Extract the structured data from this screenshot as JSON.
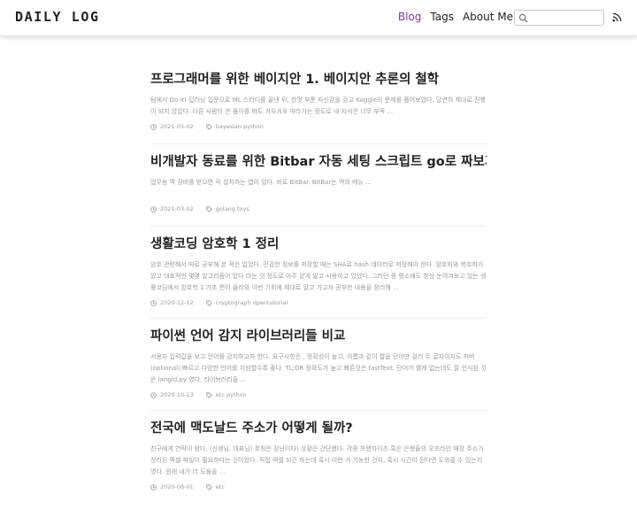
{
  "site": {
    "title": "DAILY LOG"
  },
  "nav": {
    "items": [
      {
        "label": "Blog",
        "active": true
      },
      {
        "label": "Tags",
        "active": false
      },
      {
        "label": "About Me",
        "active": false
      }
    ]
  },
  "search": {
    "placeholder": "",
    "value": ""
  },
  "colors": {
    "accent": "#7a3a93",
    "muted": "#999999"
  },
  "icons": {
    "search": "search-icon",
    "rss": "rss-icon",
    "date": "clock-icon",
    "tag": "tag-icon"
  },
  "posts": [
    {
      "title": "프로그래머를 위한 베이지안 1. 베이지안 추론의 철학",
      "summary": "텀에서 Do it! 딥러닝 입문으로 ML 스터디를 끝낸 뒤, 한껏 부푼 자신감을 갖고 Kaggle의 문제를 풀어보았다. 당연히 제대로 진행이 되지 않았다. 다른 사람이 쓴 풀이를 봐도 겨우겨우 따라가는 정도로 내 지식은 너무 부족 ...",
      "date": "2021-05-02",
      "tags": "bayesian python"
    },
    {
      "title": "비개발자 동료를 위한 Bitbar 자동 세팅 스크립트 go로 짜보기",
      "summary": "업무용 맥 장비를 받으면 꼭 설치하는 앱이 있다. 바로 BitBar. BitBar는 맥의 메뉴 ...",
      "date": "2021-03-02",
      "tags": "golang toys"
    },
    {
      "title": "생활코딩 암호학 1 정리",
      "summary": "암호 관련해서 따로 공부해 본 적은 없었다. 민감한 정보를 저장할 때는 SHA로 hash 데이터로 저장해야 한다. 암호화와 복호화가 있고 대표적인 몇몇 알고리즘이 있다 라는 것 정도로 아주 얕게 알고 사용하고 있었다. 그러던 중 평소에도 항상 눈여겨보고 있는 생활코딩에서 암호학 1 기초 편이 올라와 이번 기회에 제대로 알고 가고자 공부한 내용을 정리해 ...",
      "date": "2020-12-12",
      "tags": "cryptograph opentutorial"
    },
    {
      "title": "파이썬 언어 감지 라이브러리들 비교",
      "summary": "서용자 입력값을 보고 언어를 감지하고자 한다. 요구사항은 , 정확성이 높고, 이름과 같이 짧을 단어만 걸러 두 글자이지도 커버 (optional) 빠르고 다양한 언어를 지원할수록 좋다. TL;DR 정확도가 높고 빠른것은 fastText, 단어가 별게 없는데도 잘 인식된 것은 langid.py 였다. 라이브러리들 ...",
      "date": "2020-10-13",
      "tags": "etc python"
    },
    {
      "title": "전국에 맥도날드 주소가 어떻게 될까?",
      "summary": "친구에게 연락이 왔다. (신생님, 대표님) 호칭은 장난이다) 상황은 간단했다. 각종 프랜차이즈 혹은 은행들의 오프라인 매장 주소가 정리된 엑셀 파일이 필요하다는 것이었다. 직접 엑셀 되긴 하는데 혹시 이런 거 가능한 건지, 혹시 시간이 된다면 도와줄 수 있는지였다. 원래 내가 더 도움을 ...",
      "date": "2020-08-01",
      "tags": "etc"
    }
  ]
}
